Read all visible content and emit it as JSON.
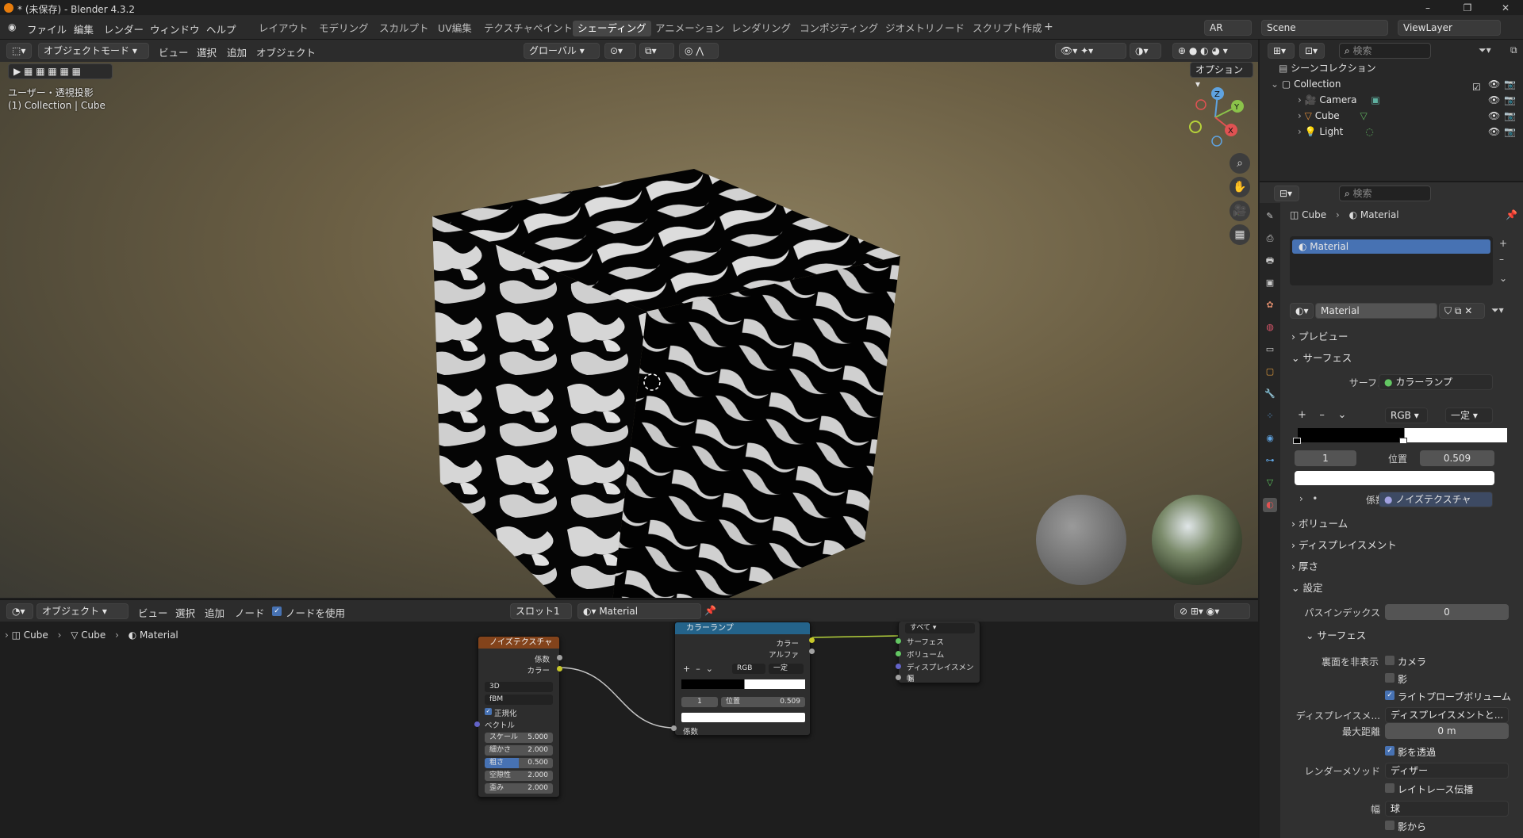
{
  "window": {
    "title": "* (未保存) - Blender 4.3.2"
  },
  "menu": [
    "ファイル",
    "編集",
    "レンダー",
    "ウィンドウ",
    "ヘルプ"
  ],
  "workspaces": [
    "レイアウト",
    "モデリング",
    "スカルプト",
    "UV編集",
    "テクスチャペイント",
    "シェーディング",
    "アニメーション",
    "レンダリング",
    "コンポジティング",
    "ジオメトリノード",
    "スクリプト作成"
  ],
  "active_workspace": "シェーディング",
  "top_right": {
    "ar": "AR",
    "scene": "Scene",
    "view_layer": "ViewLayer"
  },
  "viewport": {
    "mode": "オブジェクトモード",
    "menus": [
      "ビュー",
      "選択",
      "追加",
      "オブジェクト"
    ],
    "orientation": "グローバル",
    "options": "オプション",
    "info_line1": "ユーザー・透視投影",
    "info_line2": "(1) Collection | Cube",
    "gizmo": {
      "z": "Z",
      "y": "Y",
      "x": "X"
    }
  },
  "node_editor": {
    "type": "オブジェクト",
    "menus": [
      "ビュー",
      "選択",
      "追加",
      "ノード"
    ],
    "use_nodes": "ノードを使用",
    "slot": "スロット1",
    "material": "Material",
    "breadcrumb": [
      "Cube",
      "Cube",
      "Material"
    ],
    "noise": {
      "title": "ノイズテクスチャ",
      "out_fac": "係数",
      "out_color": "カラー",
      "dim": "3D",
      "type": "fBM",
      "normalize": "正規化",
      "vector": "ベクトル",
      "fields": [
        {
          "label": "スケール",
          "value": "5.000"
        },
        {
          "label": "細かさ",
          "value": "2.000"
        },
        {
          "label": "粗さ",
          "value": "0.500"
        },
        {
          "label": "空隙性",
          "value": "2.000"
        },
        {
          "label": "歪み",
          "value": "2.000"
        }
      ]
    },
    "ramp": {
      "title": "カラーランプ",
      "out_color": "カラー",
      "out_alpha": "アルファ",
      "mode": "RGB",
      "interp": "一定",
      "index": "1",
      "pos_label": "位置",
      "pos_value": "0.509",
      "in_fac": "係数"
    },
    "output": {
      "target": "すべて",
      "surface": "サーフェス",
      "volume": "ボリューム",
      "displacement": "ディスプレイスメント",
      "thickness": "幅"
    }
  },
  "outliner": {
    "search": "検索",
    "scene_collection": "シーンコレクション",
    "collection": "Collection",
    "items": [
      "Camera",
      "Cube",
      "Light"
    ]
  },
  "properties": {
    "search": "検索",
    "breadcrumb": [
      "Cube",
      "Material"
    ],
    "slot": "Material",
    "material_name": "Material",
    "sections": {
      "preview": "プレビュー",
      "surface": "サーフェス",
      "volume": "ボリューム",
      "displacement": "ディスプレイスメント",
      "thickness": "厚さ",
      "settings": "設定"
    },
    "surface_label": "サーフェス",
    "surface_value": "カラーランプ",
    "ramp": {
      "mode": "RGB",
      "interp": "一定",
      "index": "1",
      "pos_label": "位置",
      "pos_value": "0.509",
      "fac_label": "係数",
      "fac_value": "ノイズテクスチャ"
    },
    "pass_index_label": "パスインデックス",
    "pass_index": "0",
    "sub_surface": "サーフェス",
    "backface_label": "裏面を非表示",
    "camera": "カメラ",
    "shadow": "影",
    "light_probe": "ライトプローブボリューム",
    "displacement_label": "ディスプレイスメ...",
    "displacement_value": "ディスプレイスメントと...",
    "max_dist_label": "最大距離",
    "max_dist": "0 m",
    "transparent_shadow": "影を透過",
    "render_method_label": "レンダーメソッド",
    "render_method": "ディザー",
    "raytrace": "レイトレース伝播",
    "thickness_label": "幅",
    "thickness_value": "球",
    "from_shadow": "影から"
  },
  "colors": {
    "accent": "#4772b3",
    "active_ws": "#464646",
    "noise_header": "#83431b",
    "ramp_header": "#24638a",
    "link": "#c7c7c7"
  }
}
